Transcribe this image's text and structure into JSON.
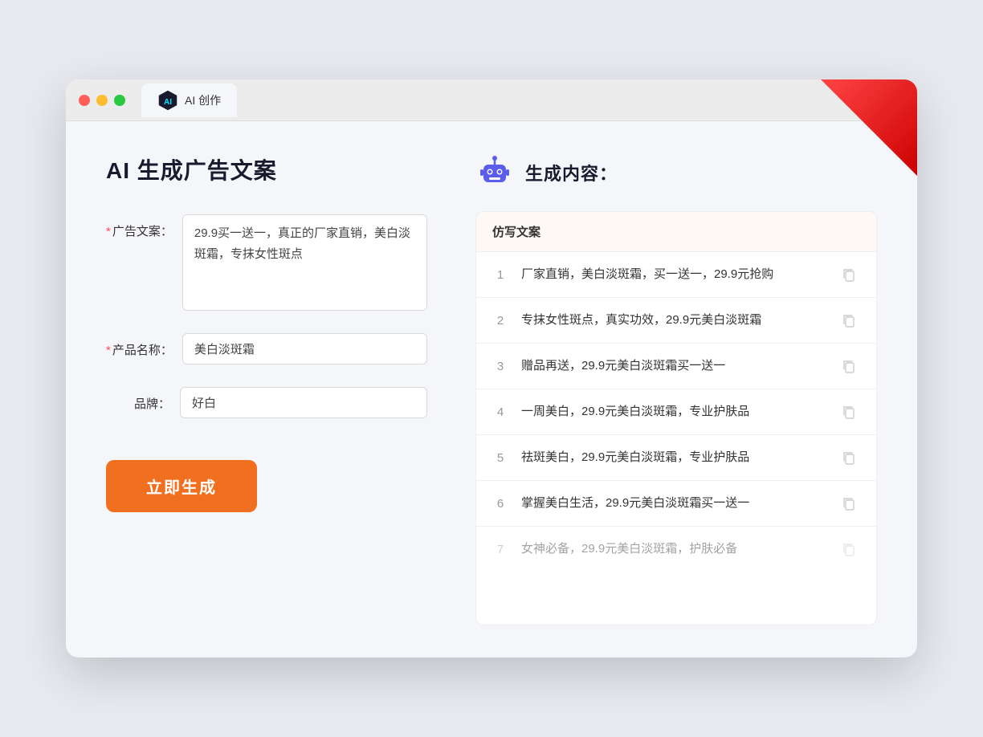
{
  "window": {
    "tab_label": "AI 创作"
  },
  "left": {
    "page_title": "AI 生成广告文案",
    "form": {
      "ad_copy_label": "广告文案：",
      "ad_copy_required": true,
      "ad_copy_value": "29.9买一送一，真正的厂家直销，美白淡斑霜，专抹女性斑点",
      "product_name_label": "产品名称：",
      "product_name_required": true,
      "product_name_value": "美白淡斑霜",
      "brand_label": "品牌：",
      "brand_required": false,
      "brand_value": "好白"
    },
    "generate_button": "立即生成"
  },
  "right": {
    "title": "生成内容：",
    "table_header": "仿写文案",
    "results": [
      {
        "num": 1,
        "text": "厂家直销，美白淡斑霜，买一送一，29.9元抢购"
      },
      {
        "num": 2,
        "text": "专抹女性斑点，真实功效，29.9元美白淡斑霜"
      },
      {
        "num": 3,
        "text": "赠品再送，29.9元美白淡斑霜买一送一"
      },
      {
        "num": 4,
        "text": "一周美白，29.9元美白淡斑霜，专业护肤品"
      },
      {
        "num": 5,
        "text": "祛斑美白，29.9元美白淡斑霜，专业护肤品"
      },
      {
        "num": 6,
        "text": "掌握美白生活，29.9元美白淡斑霜买一送一"
      },
      {
        "num": 7,
        "text": "女神必备，29.9元美白淡斑霜，护肤必备",
        "faded": true
      }
    ]
  }
}
